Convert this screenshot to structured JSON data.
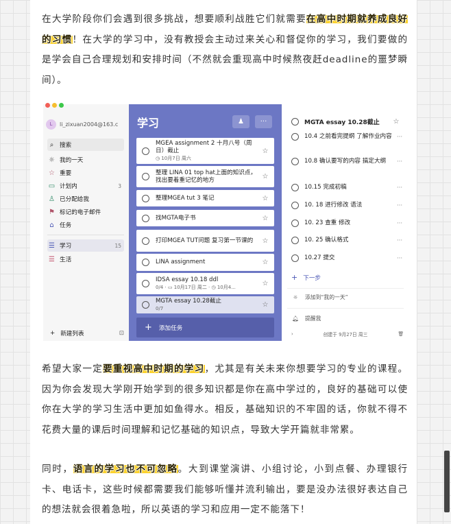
{
  "article": {
    "p1": {
      "before": "在大学阶段你们会遇到很多挑战，想要顺利战胜它们就需要",
      "highlight": "在高中时期就养成良好的习惯",
      "after": "！在大学的学习中，没有教授会主动过来关心和督促你的学习，我们要做的是学会自己合理规划和安排时间（不然就会重现高中时候熬夜赶deadline的噩梦瞬间）。"
    },
    "p2": {
      "before": "希望大家一定",
      "highlight": "要重视高中时期的学习",
      "after": "，尤其是有关未来你想要学习的专业的课程。因为你会发现大学刚开始学到的很多知识都是你在高中学过的，良好的基础可以使你在大学的学习生活中更加如鱼得水。相反，基础知识的不牢固的话，你就不得不花费大量的课后时间理解和记忆基础的知识点，导致大学开篇就非常累。"
    },
    "p3": {
      "before": "同时，",
      "highlight": "语言的学习也不可忽略",
      "after": "。大到课堂演讲、小组讨论，小到点餐、办理银行卡、电话卡，这些时候都需要我们能够听懂并流利输出，要是没办法很好表达自己的想法就会很着急啦，所以英语的学习和应用一定不能落下！"
    }
  },
  "todo_app": {
    "window_dots": [
      "#f25f57",
      "#f6be2f",
      "#3cc84a"
    ],
    "account": {
      "avatar": "L",
      "name": "li_zixuan2004@163.c"
    },
    "sidebar": {
      "search": {
        "icon": "search-icon",
        "label": "搜索"
      },
      "items": [
        {
          "icon": "sun-icon",
          "glyph": "☼",
          "label": "我的一天",
          "count": ""
        },
        {
          "icon": "star-icon",
          "glyph": "☆",
          "label": "重要",
          "count": ""
        },
        {
          "icon": "calendar-icon",
          "glyph": "▭",
          "label": "计划内",
          "count": "3"
        },
        {
          "icon": "person-icon",
          "glyph": "♙",
          "label": "已分配给我",
          "count": ""
        },
        {
          "icon": "flag-icon",
          "glyph": "⚑",
          "label": "标记的电子邮件",
          "count": ""
        },
        {
          "icon": "home-icon",
          "glyph": "⌂",
          "label": "任务",
          "count": ""
        }
      ],
      "lists": [
        {
          "icon": "list-icon",
          "glyph": "☰",
          "label": "学习",
          "count": "15"
        },
        {
          "icon": "list-icon",
          "glyph": "☰",
          "label": "生活",
          "count": ""
        }
      ],
      "new_list": "新建列表"
    },
    "main": {
      "title": "学习",
      "tasks": [
        {
          "title": "MGEA assignment 2 十月八号（周日）截止",
          "sub": "◷ 10月7日 周六"
        },
        {
          "title": "整理 LINA 01 top hat上面的知识点，找出要着重记忆的地方",
          "sub": ""
        },
        {
          "title": "整理MGEA tut 3 笔记",
          "sub": ""
        },
        {
          "title": "找MGTA电子书",
          "sub": ""
        },
        {
          "title": "打印MGEA TUT问题 复习第一节课的",
          "sub": ""
        },
        {
          "title": "LINA assignment",
          "sub": ""
        },
        {
          "title": "IDSA essay 10.18 ddl",
          "sub": "0/4 · ▭ 10月17日 周二 · ◷ 10月4..."
        },
        {
          "title": "MGTA essay 10.28截止",
          "sub": "0/7"
        }
      ],
      "add_task": "添加任务"
    },
    "detail": {
      "title": "MGTA essay 10.28截止",
      "steps": [
        "10.4 之前看完提纲 了解作业内容",
        "10.8 确认要写的内容 搞定大纲",
        "10.15 完成初稿",
        "10. 18 进行修改 语法",
        "10. 23 查重 修改",
        "10. 25 确认格式",
        "10.27 提交"
      ],
      "next_step": "下一步",
      "add_to_my_day": "添加到“我的一天”",
      "remind_me": "提醒我",
      "created": "创建于 9月27日 周三"
    }
  }
}
